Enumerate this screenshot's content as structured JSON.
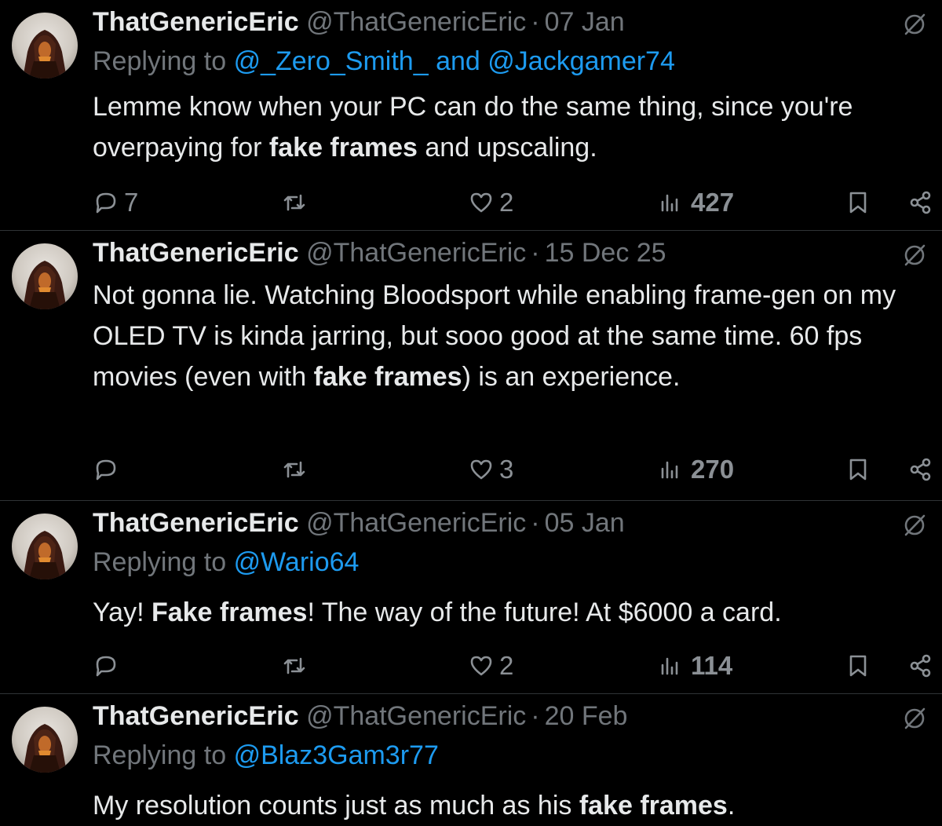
{
  "tweets": [
    {
      "name": "ThatGenericEric",
      "handle": "@ThatGenericEric",
      "dot": "·",
      "date": "07 Jan",
      "replying_prefix": "Replying to",
      "mention1": "@_Zero_Smith_",
      "conj": "and",
      "mention2": "@Jackgamer74",
      "text_a": "Lemme know when your PC can do the same thing, since you're overpaying for",
      "text_bold": "fake frames",
      "text_b": "and upscaling.",
      "replies": "7",
      "retweets": "",
      "likes": "2",
      "views": "427"
    },
    {
      "name": "ThatGenericEric",
      "handle": "@ThatGenericEric",
      "dot": "·",
      "date": "15 Dec 25",
      "text_a": "Not gonna lie. Watching Bloodsport while enabling frame-gen on my OLED TV is kinda jarring, but sooo good at the same time. 60 fps movies (even with",
      "text_bold": "fake frames",
      "text_b": ") is an experience.",
      "replies": "",
      "retweets": "",
      "likes": "3",
      "views": "270"
    },
    {
      "name": "ThatGenericEric",
      "handle": "@ThatGenericEric",
      "dot": "·",
      "date": "05 Jan",
      "replying_prefix": "Replying to",
      "mention1": "@Wario64",
      "text_a": "Yay!",
      "text_bold": "Fake frames",
      "text_b": "! The way of the future! At $6000 a card.",
      "replies": "",
      "retweets": "",
      "likes": "2",
      "views": "114"
    },
    {
      "name": "ThatGenericEric",
      "handle": "@ThatGenericEric",
      "dot": "·",
      "date": "20 Feb",
      "replying_prefix": "Replying to",
      "mention1": "@Blaz3Gam3r77",
      "text_a": "My resolution counts just as much as his",
      "text_bold": "fake frames",
      "text_b": "."
    }
  ],
  "icons": {
    "reply": "reply-icon",
    "retweet": "retweet-icon",
    "like": "heart-icon",
    "views": "views-icon",
    "bookmark": "bookmark-icon",
    "share": "share-icon",
    "grok": "grok-icon"
  },
  "colors": {
    "background": "#000000",
    "text": "#e7e9ea",
    "muted": "#71767b",
    "link": "#1d9bf0",
    "divider": "#2f3336"
  }
}
